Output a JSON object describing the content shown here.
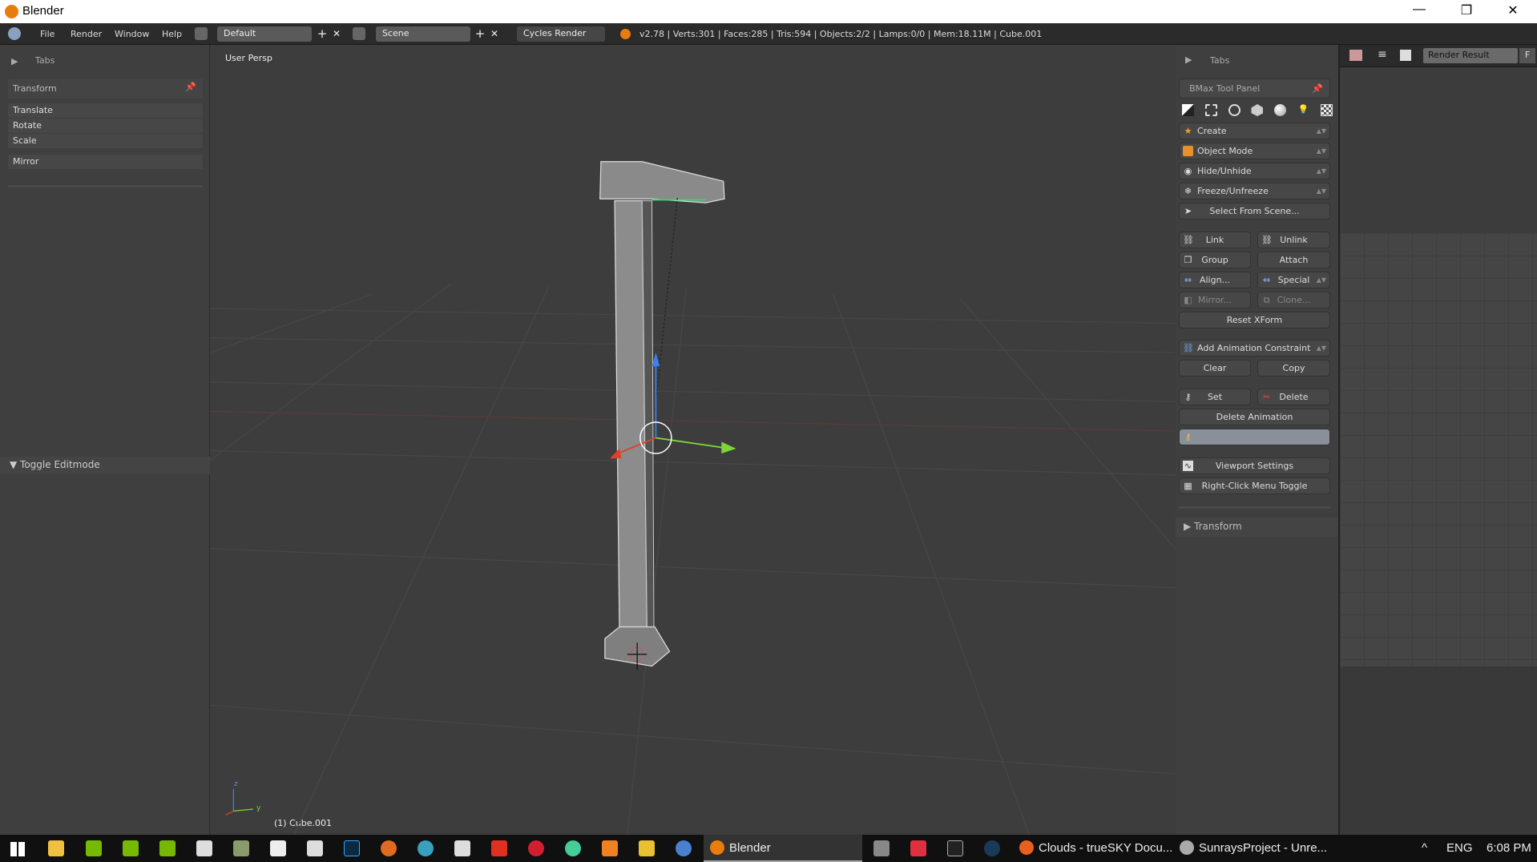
{
  "window": {
    "title": "Blender",
    "minimize": "—",
    "restore": "❐",
    "close": "✕"
  },
  "header": {
    "menus": [
      "File",
      "Render",
      "Window",
      "Help"
    ],
    "layout": "Default",
    "scene": "Scene",
    "engine": "Cycles Render",
    "stats": "v2.78 | Verts:301 | Faces:285 | Tris:594 | Objects:2/2 | Lamps:0/0 | Mem:18.11M | Cube.001",
    "add": "+",
    "remove": "✕"
  },
  "left_panel": {
    "tabs_label": "Tabs",
    "section": "Transform",
    "items": [
      "Translate",
      "Rotate",
      "Scale",
      "Mirror"
    ],
    "toggle_editmode": "▼ Toggle Editmode"
  },
  "viewport": {
    "view_label": "User Persp",
    "object_label": "(1) Cube.001",
    "axis_z": "z",
    "axis_y": "y"
  },
  "right_panel": {
    "tabs_label": "Tabs",
    "panel_title": "BMax Tool Panel",
    "dropdowns": [
      "Create",
      "Object Mode",
      "Hide/Unhide",
      "Freeze/Unfreeze"
    ],
    "select_from_scene": "Select From Scene...",
    "link": "Link",
    "unlink": "Unlink",
    "group": "Group",
    "attach": "Attach",
    "align": "Align...",
    "special": "Special",
    "mirror": "Mirror...",
    "clone": "Clone...",
    "reset_xform": "Reset XForm",
    "add_anim_constraint": "Add Animation Constraint",
    "clear": "Clear",
    "copy": "Copy",
    "set": "Set",
    "delete": "Delete",
    "delete_animation": "Delete Animation",
    "viewport_settings": "Viewport Settings",
    "right_click_toggle": "Right-Click Menu Toggle",
    "transform": "▶ Transform"
  },
  "image_editor": {
    "image": "Render Result",
    "f": "F"
  },
  "taskbar": {
    "blender": "Blender",
    "clouds": "Clouds - trueSKY Docu...",
    "sunrays": "SunraysProject - Unre...",
    "lang": "ENG",
    "time": "6:08 PM",
    "tray_arrow": "^"
  },
  "colors": {
    "accent": "#e87d0d",
    "x_axis": "#e0402a",
    "y_axis": "#7fd43a",
    "z_axis": "#3f7fe8"
  }
}
